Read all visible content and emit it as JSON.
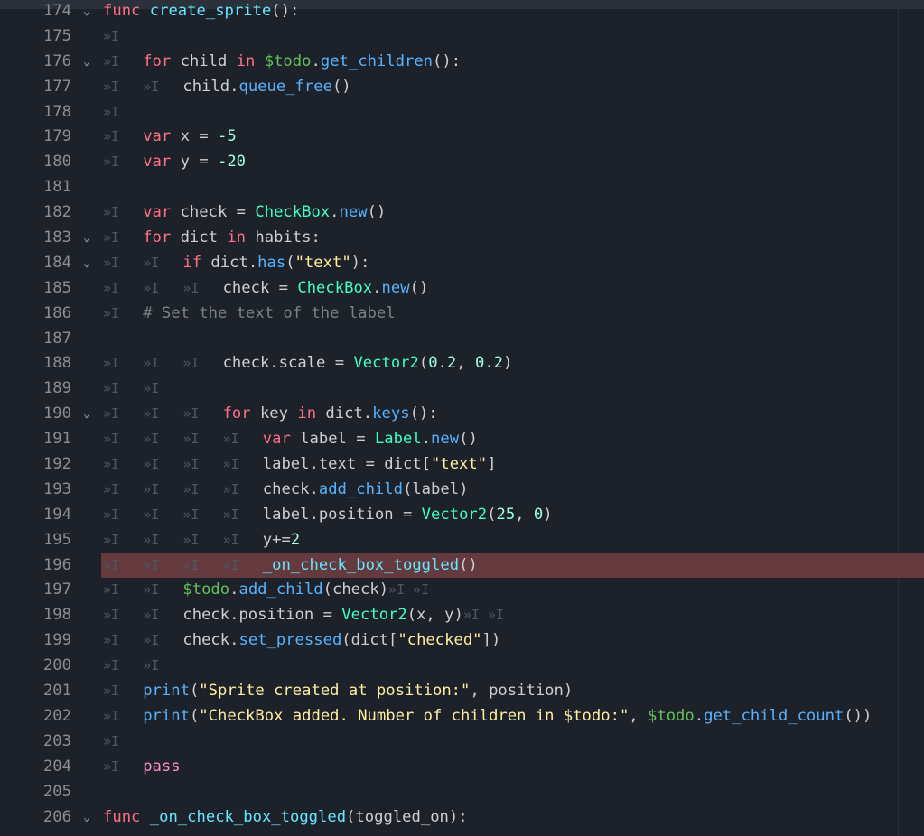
{
  "editor": {
    "lines": [
      {
        "n": "174",
        "fold": true,
        "tabs": 0,
        "parts": [
          [
            "kw",
            "func"
          ],
          [
            "id",
            " "
          ],
          [
            "fnd",
            "create_sprite"
          ],
          [
            "id",
            "():"
          ]
        ]
      },
      {
        "n": "175",
        "tabs": 1,
        "parts": []
      },
      {
        "n": "176",
        "fold": true,
        "tabs": 1,
        "parts": [
          [
            "kw",
            "for"
          ],
          [
            "id",
            " child "
          ],
          [
            "kw",
            "in"
          ],
          [
            "id",
            " "
          ],
          [
            "nd",
            "$todo"
          ],
          [
            "id",
            "."
          ],
          [
            "fn",
            "get_children"
          ],
          [
            "id",
            "():"
          ]
        ]
      },
      {
        "n": "177",
        "tabs": 2,
        "parts": [
          [
            "id",
            "child."
          ],
          [
            "fn",
            "queue_free"
          ],
          [
            "id",
            "()"
          ]
        ]
      },
      {
        "n": "178",
        "tabs": 1,
        "parts": []
      },
      {
        "n": "179",
        "tabs": 1,
        "parts": [
          [
            "kw",
            "var"
          ],
          [
            "id",
            " x = "
          ],
          [
            "nm",
            "-5"
          ]
        ]
      },
      {
        "n": "180",
        "tabs": 1,
        "parts": [
          [
            "kw",
            "var"
          ],
          [
            "id",
            " y = "
          ],
          [
            "nm",
            "-20"
          ]
        ]
      },
      {
        "n": "181",
        "tabs": 0,
        "parts": []
      },
      {
        "n": "182",
        "tabs": 1,
        "parts": [
          [
            "kw",
            "var"
          ],
          [
            "id",
            " check = "
          ],
          [
            "ty",
            "CheckBox"
          ],
          [
            "id",
            "."
          ],
          [
            "fn",
            "new"
          ],
          [
            "id",
            "()"
          ]
        ]
      },
      {
        "n": "183",
        "fold": true,
        "tabs": 1,
        "parts": [
          [
            "kw",
            "for"
          ],
          [
            "id",
            " dict "
          ],
          [
            "kw",
            "in"
          ],
          [
            "id",
            " habits:"
          ]
        ]
      },
      {
        "n": "184",
        "fold": true,
        "tabs": 2,
        "parts": [
          [
            "kw",
            "if"
          ],
          [
            "id",
            " dict."
          ],
          [
            "fn",
            "has"
          ],
          [
            "id",
            "("
          ],
          [
            "st",
            "\"text\""
          ],
          [
            "id",
            "):"
          ]
        ]
      },
      {
        "n": "185",
        "tabs": 3,
        "parts": [
          [
            "id",
            "check = "
          ],
          [
            "ty",
            "CheckBox"
          ],
          [
            "id",
            "."
          ],
          [
            "fn",
            "new"
          ],
          [
            "id",
            "()"
          ]
        ]
      },
      {
        "n": "186",
        "tabs": 1,
        "parts": [
          [
            "cm",
            "# Set the text of the label"
          ]
        ]
      },
      {
        "n": "187",
        "tabs": 0,
        "parts": []
      },
      {
        "n": "188",
        "tabs": 3,
        "parts": [
          [
            "id",
            "check.scale = "
          ],
          [
            "ty",
            "Vector2"
          ],
          [
            "id",
            "("
          ],
          [
            "nm",
            "0.2"
          ],
          [
            "id",
            ", "
          ],
          [
            "nm",
            "0.2"
          ],
          [
            "id",
            ")"
          ]
        ]
      },
      {
        "n": "189",
        "tabs": 2,
        "parts": []
      },
      {
        "n": "190",
        "fold": true,
        "tabs": 3,
        "parts": [
          [
            "kw",
            "for"
          ],
          [
            "id",
            " key "
          ],
          [
            "kw",
            "in"
          ],
          [
            "id",
            " dict."
          ],
          [
            "fn",
            "keys"
          ],
          [
            "id",
            "():"
          ]
        ]
      },
      {
        "n": "191",
        "tabs": 4,
        "parts": [
          [
            "kw",
            "var"
          ],
          [
            "id",
            " label = "
          ],
          [
            "ty",
            "Label"
          ],
          [
            "id",
            "."
          ],
          [
            "fn",
            "new"
          ],
          [
            "id",
            "()"
          ]
        ]
      },
      {
        "n": "192",
        "tabs": 4,
        "parts": [
          [
            "id",
            "label.text = dict["
          ],
          [
            "st",
            "\"text\""
          ],
          [
            "id",
            "]"
          ]
        ]
      },
      {
        "n": "193",
        "tabs": 4,
        "parts": [
          [
            "id",
            "check."
          ],
          [
            "fn",
            "add_child"
          ],
          [
            "id",
            "(label)"
          ]
        ]
      },
      {
        "n": "194",
        "tabs": 4,
        "parts": [
          [
            "id",
            "label.position = "
          ],
          [
            "ty",
            "Vector2"
          ],
          [
            "id",
            "("
          ],
          [
            "nm",
            "25"
          ],
          [
            "id",
            ", "
          ],
          [
            "nm",
            "0"
          ],
          [
            "id",
            ")"
          ]
        ]
      },
      {
        "n": "195",
        "tabs": 4,
        "parts": [
          [
            "id",
            "y+="
          ],
          [
            "nm",
            "2"
          ]
        ]
      },
      {
        "n": "196",
        "highlight": true,
        "tabs": 4,
        "parts": [
          [
            "fnd",
            "_on_check_box_toggled"
          ],
          [
            "id",
            "()"
          ]
        ]
      },
      {
        "n": "197",
        "tabs": 2,
        "parts": [
          [
            "nd",
            "$todo"
          ],
          [
            "id",
            "."
          ],
          [
            "fn",
            "add_child"
          ],
          [
            "id",
            "(check)"
          ],
          [
            "tab2",
            "»I »I"
          ]
        ]
      },
      {
        "n": "198",
        "tabs": 2,
        "parts": [
          [
            "id",
            "check.position = "
          ],
          [
            "ty",
            "Vector2"
          ],
          [
            "id",
            "(x, y)"
          ],
          [
            "tab2",
            "»I »I"
          ]
        ]
      },
      {
        "n": "199",
        "tabs": 2,
        "parts": [
          [
            "id",
            "check."
          ],
          [
            "fn",
            "set_pressed"
          ],
          [
            "id",
            "(dict["
          ],
          [
            "st",
            "\"checked\""
          ],
          [
            "id",
            "])"
          ]
        ]
      },
      {
        "n": "200",
        "tabs": 2,
        "parts": []
      },
      {
        "n": "201",
        "tabs": 1,
        "parts": [
          [
            "fn",
            "print"
          ],
          [
            "id",
            "("
          ],
          [
            "st",
            "\"Sprite created at position:\""
          ],
          [
            "id",
            ", position)"
          ]
        ]
      },
      {
        "n": "202",
        "tabs": 1,
        "parts": [
          [
            "fn",
            "print"
          ],
          [
            "id",
            "("
          ],
          [
            "st",
            "\"CheckBox added. Number of children in $todo:\""
          ],
          [
            "id",
            ", "
          ],
          [
            "nd",
            "$todo"
          ],
          [
            "id",
            "."
          ],
          [
            "fn",
            "get_child_count"
          ],
          [
            "id",
            "())"
          ]
        ]
      },
      {
        "n": "203",
        "tabs": 1,
        "parts": []
      },
      {
        "n": "204",
        "tabs": 1,
        "parts": [
          [
            "kw2",
            "pass"
          ]
        ]
      },
      {
        "n": "205",
        "tabs": 0,
        "parts": []
      },
      {
        "n": "206",
        "fold": true,
        "tabs": 0,
        "parts": [
          [
            "kw",
            "func"
          ],
          [
            "id",
            " "
          ],
          [
            "fnd",
            "_on_check_box_toggled"
          ],
          [
            "id",
            "(toggled_on):"
          ]
        ]
      }
    ]
  },
  "glyphs": {
    "tab": "»I",
    "fold": "⌄"
  },
  "colors": {
    "background": "#1d2129",
    "highlight_line": "#643a3e",
    "keyword": "#ff7085",
    "type": "#42ffc2",
    "function_call": "#57b3ff",
    "string": "#ffeda1",
    "node_path": "#63c259",
    "number": "#a1ffe0",
    "comment": "#7d8289"
  }
}
